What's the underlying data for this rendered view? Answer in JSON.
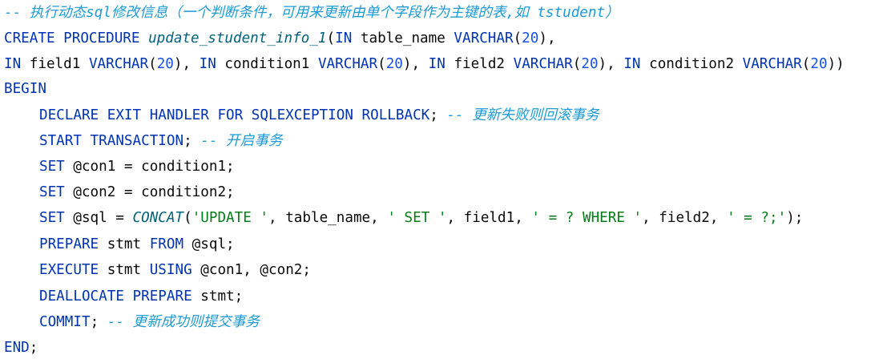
{
  "lines": [
    {
      "indent": false,
      "tokens": [
        {
          "t": "-- 执行动态sql修改信息（一个判断条件，可用来更新由单个字段作为主键的表,如 tstudent）",
          "c": "cm"
        }
      ]
    },
    {
      "indent": false,
      "tokens": [
        {
          "t": "CREATE PROCEDURE ",
          "c": "kw"
        },
        {
          "t": "update_student_info_1",
          "c": "fn"
        },
        {
          "t": "(",
          "c": "id"
        },
        {
          "t": "IN",
          "c": "kw"
        },
        {
          "t": " table_name ",
          "c": "id"
        },
        {
          "t": "VARCHAR",
          "c": "kw"
        },
        {
          "t": "(",
          "c": "id"
        },
        {
          "t": "20",
          "c": "num"
        },
        {
          "t": "),",
          "c": "id"
        }
      ]
    },
    {
      "indent": false,
      "tokens": [
        {
          "t": "IN",
          "c": "kw"
        },
        {
          "t": " field1 ",
          "c": "id"
        },
        {
          "t": "VARCHAR",
          "c": "kw"
        },
        {
          "t": "(",
          "c": "id"
        },
        {
          "t": "20",
          "c": "num"
        },
        {
          "t": "), ",
          "c": "id"
        },
        {
          "t": "IN",
          "c": "kw"
        },
        {
          "t": " condition1 ",
          "c": "id"
        },
        {
          "t": "VARCHAR",
          "c": "kw"
        },
        {
          "t": "(",
          "c": "id"
        },
        {
          "t": "20",
          "c": "num"
        },
        {
          "t": "), ",
          "c": "id"
        },
        {
          "t": "IN",
          "c": "kw"
        },
        {
          "t": " field2 ",
          "c": "id"
        },
        {
          "t": "VARCHAR",
          "c": "kw"
        },
        {
          "t": "(",
          "c": "id"
        },
        {
          "t": "20",
          "c": "num"
        },
        {
          "t": "), ",
          "c": "id"
        },
        {
          "t": "IN",
          "c": "kw"
        },
        {
          "t": " condition2 ",
          "c": "id"
        },
        {
          "t": "VARCHAR",
          "c": "kw"
        },
        {
          "t": "(",
          "c": "id"
        },
        {
          "t": "20",
          "c": "num"
        },
        {
          "t": "))",
          "c": "id"
        }
      ]
    },
    {
      "indent": false,
      "tokens": [
        {
          "t": "BEGIN",
          "c": "kw"
        }
      ]
    },
    {
      "indent": true,
      "tokens": [
        {
          "t": "DECLARE EXIT HANDLER FOR SQLEXCEPTION ROLLBACK",
          "c": "kw"
        },
        {
          "t": "; ",
          "c": "id"
        },
        {
          "t": "-- 更新失败则回滚事务",
          "c": "cm"
        }
      ]
    },
    {
      "indent": true,
      "tokens": [
        {
          "t": "START TRANSACTION",
          "c": "kw"
        },
        {
          "t": "; ",
          "c": "id"
        },
        {
          "t": "-- 开启事务",
          "c": "cm"
        }
      ]
    },
    {
      "indent": true,
      "tokens": [
        {
          "t": "SET",
          "c": "kw"
        },
        {
          "t": " @con1 = condition1;",
          "c": "id"
        }
      ]
    },
    {
      "indent": true,
      "tokens": [
        {
          "t": "SET",
          "c": "kw"
        },
        {
          "t": " @con2 = condition2;",
          "c": "id"
        }
      ]
    },
    {
      "indent": true,
      "tokens": [
        {
          "t": "SET",
          "c": "kw"
        },
        {
          "t": " @sql = ",
          "c": "id"
        },
        {
          "t": "CONCAT",
          "c": "fn"
        },
        {
          "t": "(",
          "c": "id"
        },
        {
          "t": "'UPDATE '",
          "c": "str"
        },
        {
          "t": ", table_name, ",
          "c": "id"
        },
        {
          "t": "' SET '",
          "c": "str"
        },
        {
          "t": ", field1, ",
          "c": "id"
        },
        {
          "t": "' = ? WHERE '",
          "c": "str"
        },
        {
          "t": ", field2, ",
          "c": "id"
        },
        {
          "t": "' = ?;'",
          "c": "str"
        },
        {
          "t": ");",
          "c": "id"
        }
      ]
    },
    {
      "indent": true,
      "tokens": [
        {
          "t": "PREPARE",
          "c": "kw"
        },
        {
          "t": " stmt ",
          "c": "id"
        },
        {
          "t": "FROM",
          "c": "kw"
        },
        {
          "t": " @sql;",
          "c": "id"
        }
      ]
    },
    {
      "indent": true,
      "tokens": [
        {
          "t": "EXECUTE",
          "c": "kw"
        },
        {
          "t": " stmt ",
          "c": "id"
        },
        {
          "t": "USING",
          "c": "kw"
        },
        {
          "t": " @con1, @con2;",
          "c": "id"
        }
      ]
    },
    {
      "indent": true,
      "tokens": [
        {
          "t": "DEALLOCATE PREPARE",
          "c": "kw"
        },
        {
          "t": " stmt;",
          "c": "id"
        }
      ]
    },
    {
      "indent": true,
      "tokens": [
        {
          "t": "COMMIT",
          "c": "kw"
        },
        {
          "t": "; ",
          "c": "id"
        },
        {
          "t": "-- 更新成功则提交事务",
          "c": "cm"
        }
      ]
    },
    {
      "indent": false,
      "tokens": [
        {
          "t": "END",
          "c": "kw"
        },
        {
          "t": ";",
          "c": "id"
        }
      ]
    }
  ]
}
